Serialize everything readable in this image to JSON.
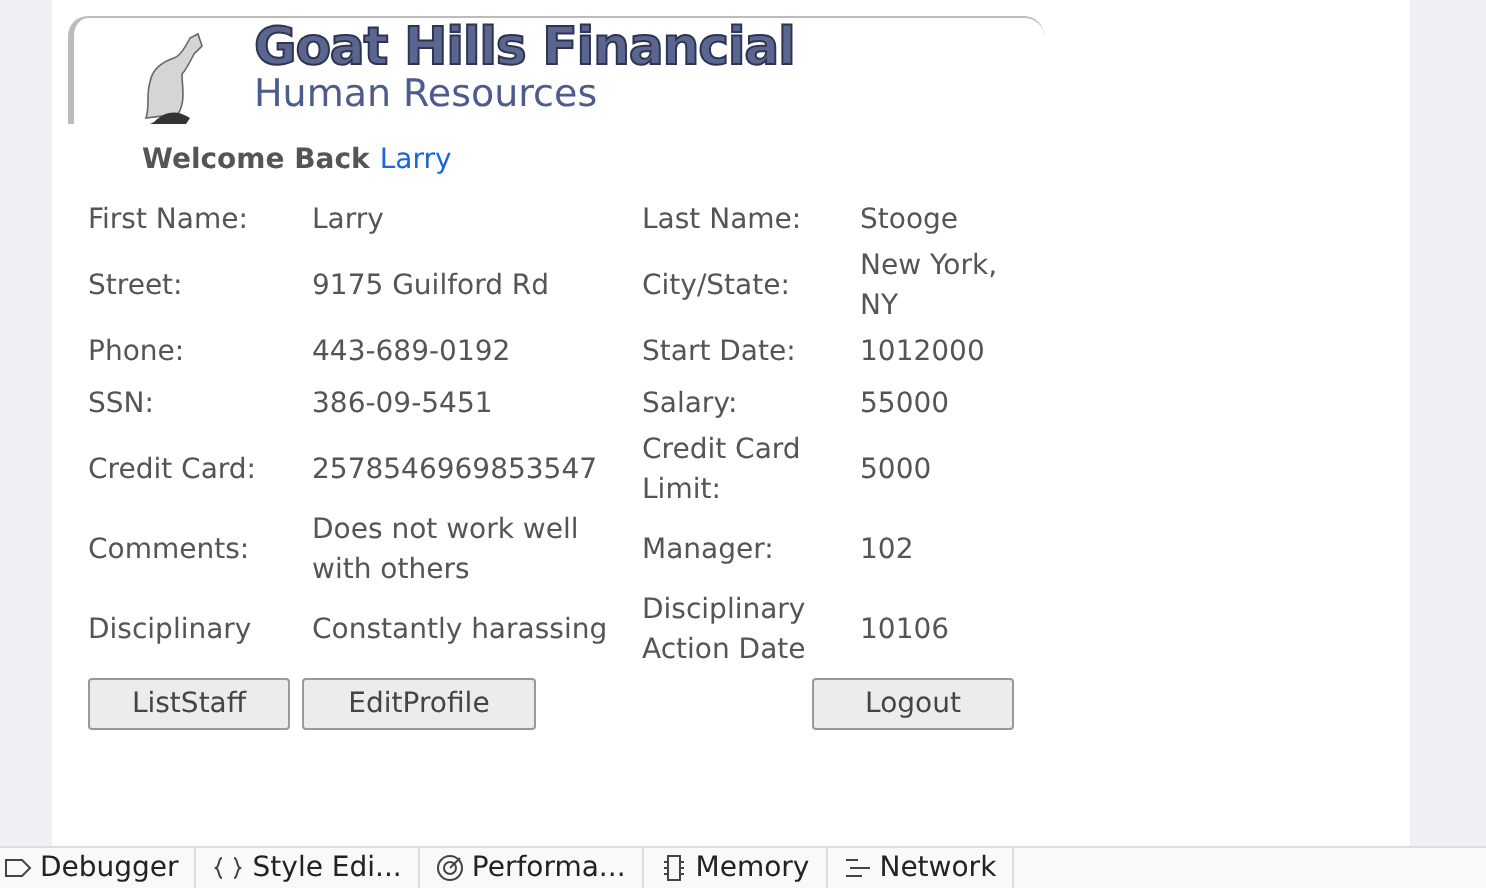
{
  "header": {
    "title": "Goat Hills Financial",
    "subtitle": "Human Resources"
  },
  "welcome": {
    "text": "Welcome Back",
    "name": "Larry"
  },
  "profile": [
    {
      "label": "First Name:",
      "value": "Larry",
      "label_2": "Last Name:",
      "value_2": "Stooge"
    },
    {
      "label": "Street:",
      "value": "9175 Guilford Rd",
      "label_2": "City/State:",
      "value_2": "New York, NY"
    },
    {
      "label": "Phone:",
      "value": "443-689-0192",
      "label_2": "Start Date:",
      "value_2": "1012000"
    },
    {
      "label": "SSN:",
      "value": "386-09-5451",
      "label_2": "Salary:",
      "value_2": "55000"
    },
    {
      "label": "Credit Card:",
      "value": "2578546969853547",
      "label_2": "Credit Card Limit:",
      "value_2": "5000"
    },
    {
      "label": "Comments:",
      "value": "Does not work well with others",
      "label_2": "Manager:",
      "value_2": "102"
    },
    {
      "label": "Disciplinary",
      "value": "Constantly harassing",
      "label_2": "Disciplinary Action Date",
      "value_2": "10106"
    }
  ],
  "buttons": [
    "ListStaff",
    "EditProfile",
    "Logout"
  ],
  "devtools_tabs": [
    {
      "kind": "debugger",
      "label": "Debugger"
    },
    {
      "kind": "style",
      "label": "Style Edi..."
    },
    {
      "kind": "performance",
      "label": "Performa..."
    },
    {
      "kind": "memory",
      "label": "Memory"
    },
    {
      "kind": "network",
      "label": "Network"
    }
  ]
}
